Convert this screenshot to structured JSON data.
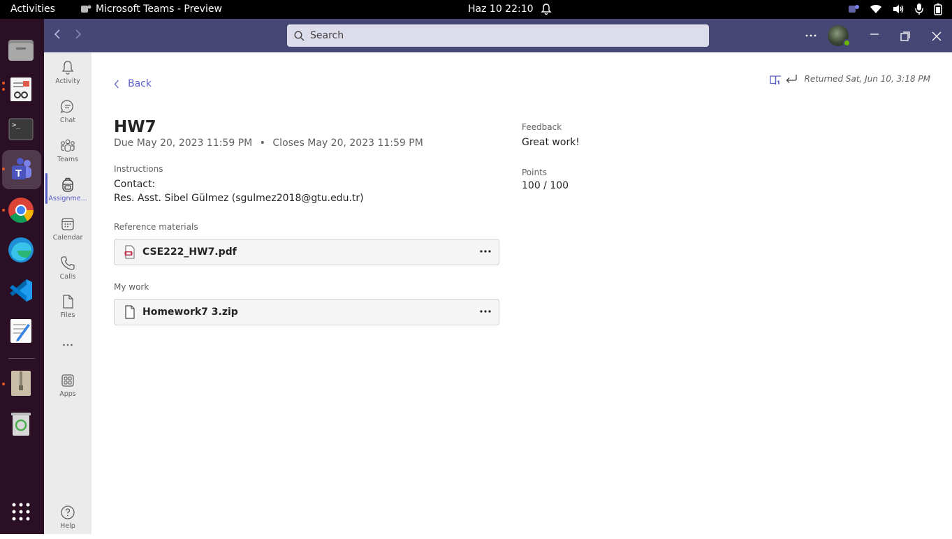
{
  "system_bar": {
    "activities": "Activities",
    "app_title": "Microsoft Teams - Preview",
    "clock": "Haz 10  22:10"
  },
  "titlebar": {
    "search_placeholder": "Search"
  },
  "rail": {
    "items": [
      {
        "label": "Activity"
      },
      {
        "label": "Chat"
      },
      {
        "label": "Teams"
      },
      {
        "label": "Assignme..."
      },
      {
        "label": "Calendar"
      },
      {
        "label": "Calls"
      },
      {
        "label": "Files"
      },
      {
        "label": "Apps"
      },
      {
        "label": "Help"
      }
    ]
  },
  "assignment": {
    "back_label": "Back",
    "returned_text": "Returned Sat, Jun 10, 3:18 PM",
    "title": "HW7",
    "due_text": "Due May 20, 2023 11:59 PM",
    "closes_text": "Closes May 20, 2023 11:59 PM",
    "separator": "•",
    "instructions_label": "Instructions",
    "instructions_line1": "Contact:",
    "instructions_line2": "Res. Asst. Sibel Gülmez (sgulmez2018@gtu.edu.tr)",
    "reference_label": "Reference materials",
    "reference_file": "CSE222_HW7.pdf",
    "my_work_label": "My work",
    "my_work_file": "Homework7 3.zip",
    "feedback_label": "Feedback",
    "feedback_text": "Great work!",
    "points_label": "Points",
    "points_text": "100 / 100"
  }
}
